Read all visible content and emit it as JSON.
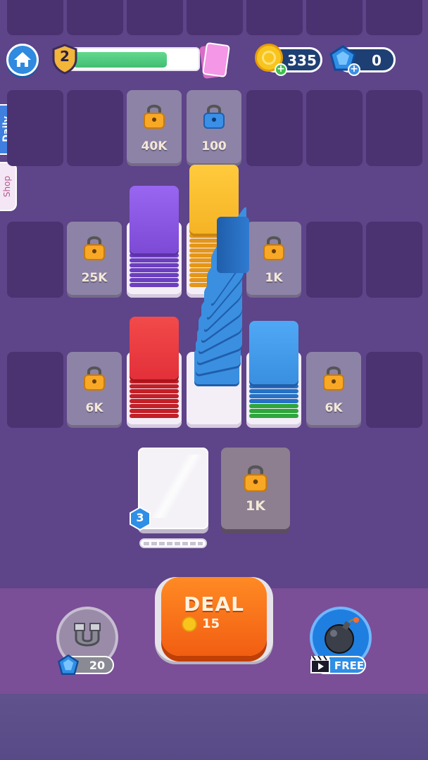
{
  "hud": {
    "level": "2",
    "coins": "335",
    "gems": "0",
    "xp_progress": 0.78
  },
  "side_tabs": {
    "daily": "Daily",
    "shop": "Shop"
  },
  "locked_tiles": {
    "t40k": "40K",
    "t100": "100",
    "t25k": "25K",
    "t1k_right": "1K",
    "t6k_left": "6K",
    "t6k_right": "6K",
    "t1k_hand": "1K"
  },
  "hand": {
    "count": "3"
  },
  "boosters": {
    "magnet_cost": "20",
    "bomb_label": "FREE"
  },
  "deal": {
    "label": "DEAL",
    "cost": "15"
  },
  "colors": {
    "purple_card": "#8a55e0",
    "yellow_card": "#f5b82a",
    "red_card": "#e8323a",
    "blue_card": "#3a8fe0",
    "green_card": "#3cc24a",
    "deal_orange": "#f26a1b"
  },
  "icons": [
    "home-icon",
    "level-shield-icon",
    "card-pack-icon",
    "coin-icon",
    "gem-icon",
    "lock-icon",
    "magnet-icon",
    "bomb-icon",
    "video-ad-icon"
  ]
}
